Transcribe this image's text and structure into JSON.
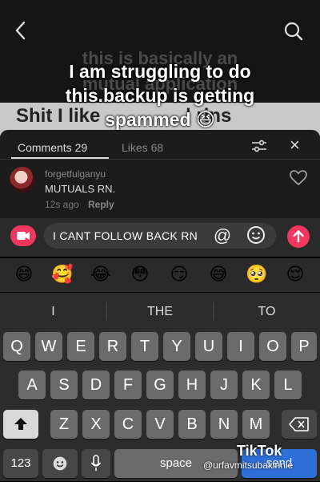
{
  "video": {
    "bg_line1": "this is basically an",
    "bg_line2": "mutual application",
    "bg_line3": "Shit I like",
    "bg_line4": "| rins",
    "caption_line1": "I am struggling to do",
    "caption_line2": "this.backup is getting",
    "caption_line3": "spammed 😆"
  },
  "comments_panel": {
    "tab_comments": "Comments 29",
    "tab_likes": "Likes 68",
    "close_icon": "×",
    "comment": {
      "username": "forgetfulganyu",
      "text": "MUTUALS RN.",
      "time": "12s ago",
      "reply": "Reply"
    }
  },
  "input": {
    "value": "I CANT FOLLOW BACK RN",
    "mention_symbol": "@"
  },
  "emoji_bar": [
    "😄",
    "🥰",
    "😂",
    "😳",
    "😏",
    "😅",
    "🥺",
    "😌"
  ],
  "keyboard": {
    "suggestions": [
      "I",
      "THE",
      "TO"
    ],
    "row1": [
      "Q",
      "W",
      "E",
      "R",
      "T",
      "Y",
      "U",
      "I",
      "O",
      "P"
    ],
    "row2": [
      "A",
      "S",
      "D",
      "F",
      "G",
      "H",
      "J",
      "K",
      "L"
    ],
    "row3": [
      "Z",
      "X",
      "C",
      "V",
      "B",
      "N",
      "M"
    ],
    "numbers_key": "123",
    "space_key": "space",
    "send_key": "send"
  },
  "watermark": {
    "logo": "TikTok",
    "handle": "@urfavmitsubakinnie"
  },
  "colors": {
    "accent": "#f0375e",
    "sheet": "#1c1c1c",
    "key": "#6b6b6b"
  }
}
